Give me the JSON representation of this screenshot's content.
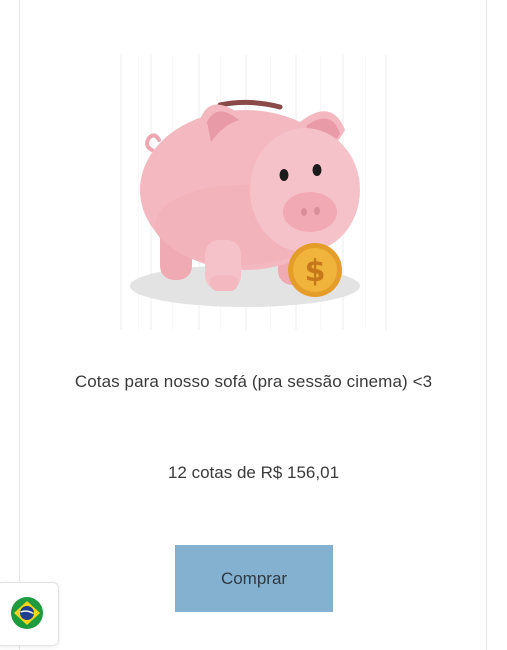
{
  "product": {
    "title": "Cotas para nosso sofá (pra sessão cinema) <3",
    "price_text": "12 cotas de R$ 156,01",
    "image_icon": "piggy-bank-illustration"
  },
  "actions": {
    "buy_label": "Comprar"
  },
  "language_selector": {
    "icon": "brazil-flag-icon"
  },
  "colors": {
    "button_bg": "#84b1cf",
    "pig_pink": "#f4b8c0",
    "coin_gold": "#f0b43c",
    "text": "#3a3a3a"
  }
}
